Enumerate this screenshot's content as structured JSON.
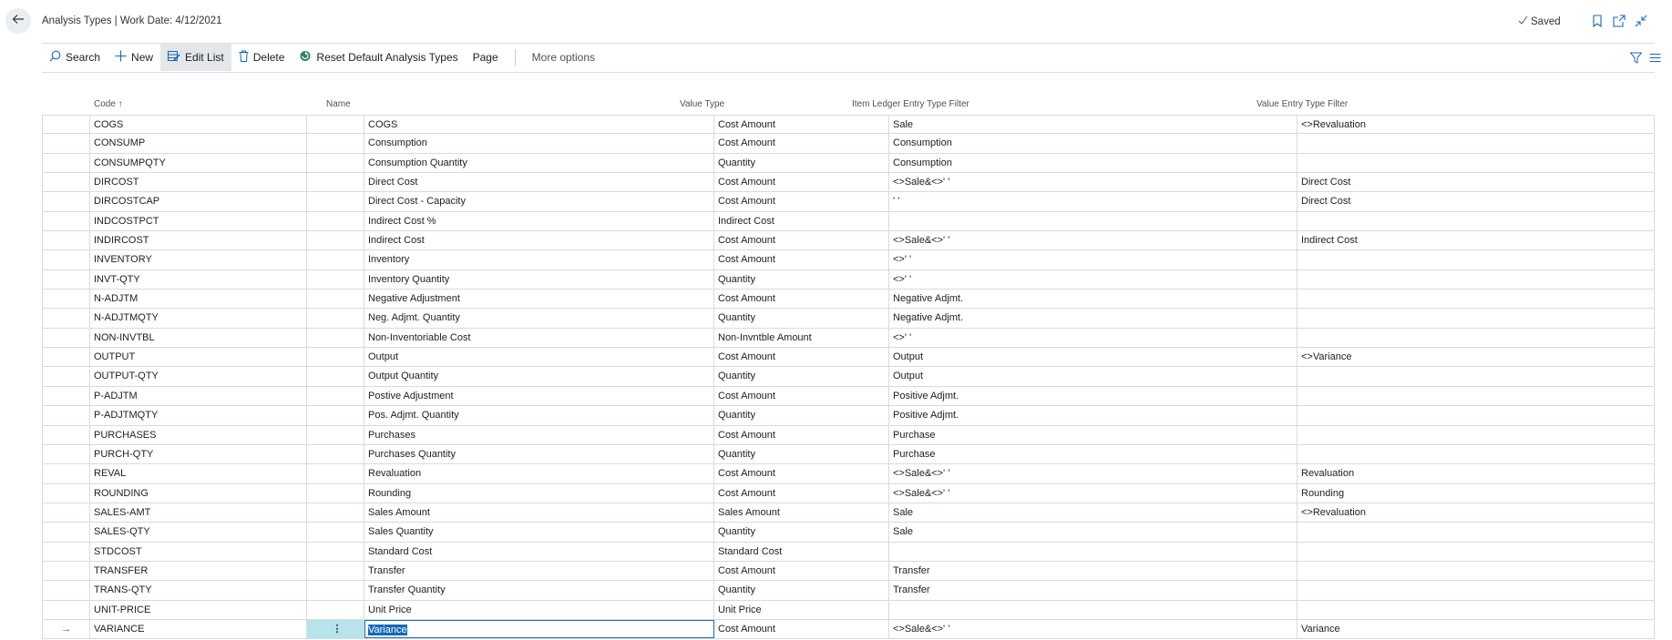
{
  "header": {
    "title": "Analysis Types | Work Date: 4/12/2021",
    "saved_label": "Saved"
  },
  "toolbar": {
    "search": "Search",
    "new": "New",
    "edit_list": "Edit List",
    "delete": "Delete",
    "reset_default": "Reset Default Analysis Types",
    "page": "Page",
    "more_options": "More options"
  },
  "table": {
    "columns": {
      "code": "Code ↑",
      "name": "Name",
      "value_type": "Value Type",
      "item_ledger_filter": "Item Ledger Entry Type Filter",
      "value_entry_filter": "Value Entry Type Filter"
    },
    "rows": [
      [
        "COGS",
        "COGS",
        "Cost Amount",
        "Sale",
        "<>Revaluation"
      ],
      [
        "CONSUMP",
        "Consumption",
        "Cost Amount",
        "Consumption",
        ""
      ],
      [
        "CONSUMPQTY",
        "Consumption Quantity",
        "Quantity",
        "Consumption",
        ""
      ],
      [
        "DIRCOST",
        "Direct Cost",
        "Cost Amount",
        "<>Sale&<>' '",
        "Direct Cost"
      ],
      [
        "DIRCOSTCAP",
        "Direct Cost - Capacity",
        "Cost Amount",
        "' '",
        "Direct Cost"
      ],
      [
        "INDCOSTPCT",
        "Indirect Cost %",
        "Indirect Cost",
        "",
        ""
      ],
      [
        "INDIRCOST",
        "Indirect Cost",
        "Cost Amount",
        "<>Sale&<>' '",
        "Indirect Cost"
      ],
      [
        "INVENTORY",
        "Inventory",
        "Cost Amount",
        "<>' '",
        ""
      ],
      [
        "INVT-QTY",
        "Inventory Quantity",
        "Quantity",
        "<>' '",
        ""
      ],
      [
        "N-ADJTM",
        "Negative Adjustment",
        "Cost Amount",
        "Negative Adjmt.",
        ""
      ],
      [
        "N-ADJTMQTY",
        "Neg. Adjmt. Quantity",
        "Quantity",
        "Negative Adjmt.",
        ""
      ],
      [
        "NON-INVTBL",
        "Non-Inventoriable Cost",
        "Non-Invntble Amount",
        "<>' '",
        ""
      ],
      [
        "OUTPUT",
        "Output",
        "Cost Amount",
        "Output",
        "<>Variance"
      ],
      [
        "OUTPUT-QTY",
        "Output Quantity",
        "Quantity",
        "Output",
        ""
      ],
      [
        "P-ADJTM",
        "Postive Adjustment",
        "Cost Amount",
        "Positive Adjmt.",
        ""
      ],
      [
        "P-ADJTMQTY",
        "Pos. Adjmt. Quantity",
        "Quantity",
        "Positive Adjmt.",
        ""
      ],
      [
        "PURCHASES",
        "Purchases",
        "Cost Amount",
        "Purchase",
        ""
      ],
      [
        "PURCH-QTY",
        "Purchases Quantity",
        "Quantity",
        "Purchase",
        ""
      ],
      [
        "REVAL",
        "Revaluation",
        "Cost Amount",
        "<>Sale&<>' '",
        "Revaluation"
      ],
      [
        "ROUNDING",
        "Rounding",
        "Cost Amount",
        "<>Sale&<>' '",
        "Rounding"
      ],
      [
        "SALES-AMT",
        "Sales Amount",
        "Sales Amount",
        "Sale",
        "<>Revaluation"
      ],
      [
        "SALES-QTY",
        "Sales Quantity",
        "Quantity",
        "Sale",
        ""
      ],
      [
        "STDCOST",
        "Standard Cost",
        "Standard Cost",
        "",
        ""
      ],
      [
        "TRANSFER",
        "Transfer",
        "Cost Amount",
        "Transfer",
        ""
      ],
      [
        "TRANS-QTY",
        "Transfer Quantity",
        "Quantity",
        "Transfer",
        ""
      ],
      [
        "UNIT-PRICE",
        "Unit Price",
        "Unit Price",
        "",
        ""
      ],
      [
        "VARIANCE",
        "Variance",
        "Cost Amount",
        "<>Sale&<>' '",
        "Variance"
      ]
    ],
    "current_row_index": 26,
    "current_row_marker": "→",
    "row_menu_glyph": "⋮"
  },
  "colors": {
    "accent": "#1468b6",
    "selection": "#b6e4ea",
    "toolbar_active": "#e3e7ea"
  },
  "icons": [
    "back-arrow-icon",
    "checkmark-icon",
    "bookmark-icon",
    "open-new-window-icon",
    "collapse-icon",
    "search-icon",
    "plus-icon",
    "edit-list-icon",
    "trash-icon",
    "reset-icon",
    "filter-icon",
    "list-view-icon"
  ]
}
